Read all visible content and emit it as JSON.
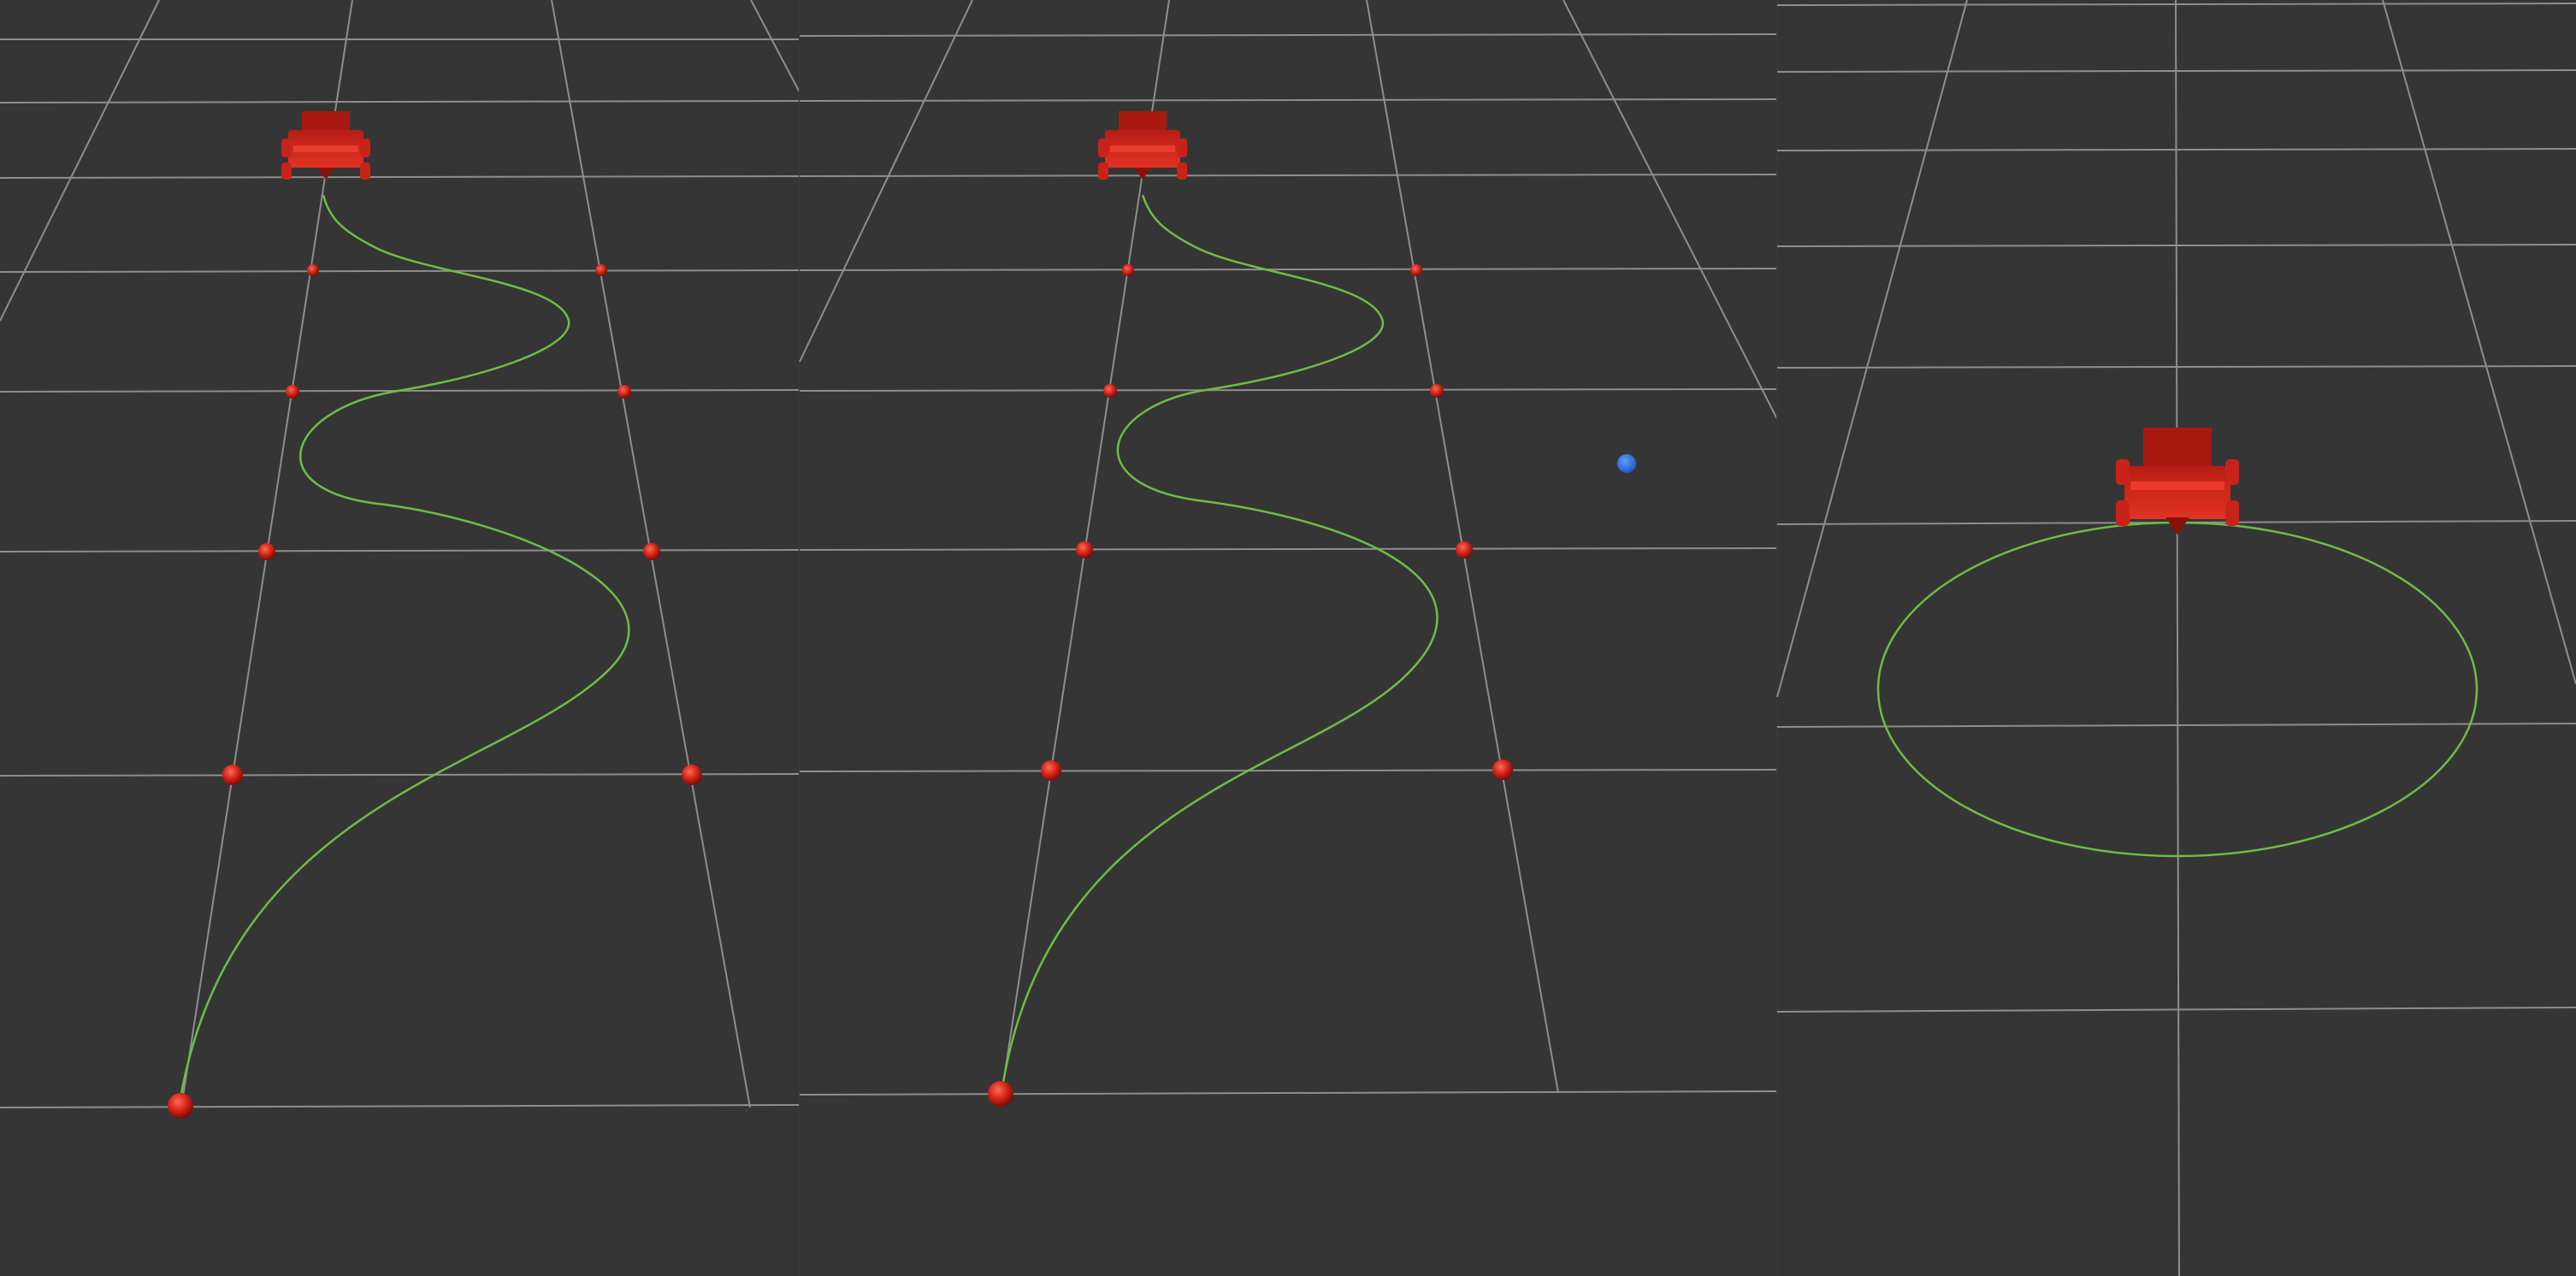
{
  "app": {
    "title": ""
  },
  "scene": {
    "background_color": "#353535",
    "grid_color": "#8e8e8e",
    "path_color": "#6dbd45",
    "marker_color": "#d42418",
    "goal_color": "#2a6fd6",
    "robot_color": "#c8231a",
    "panels": [
      {
        "id": "left",
        "path_shape": "s-curve",
        "waypoints_per_side": 4,
        "has_goal_marker": false
      },
      {
        "id": "middle",
        "path_shape": "s-curve",
        "waypoints_per_side": 4,
        "has_goal_marker": true
      },
      {
        "id": "right",
        "path_shape": "ellipse",
        "waypoints_per_side": 0,
        "has_goal_marker": false
      }
    ]
  }
}
